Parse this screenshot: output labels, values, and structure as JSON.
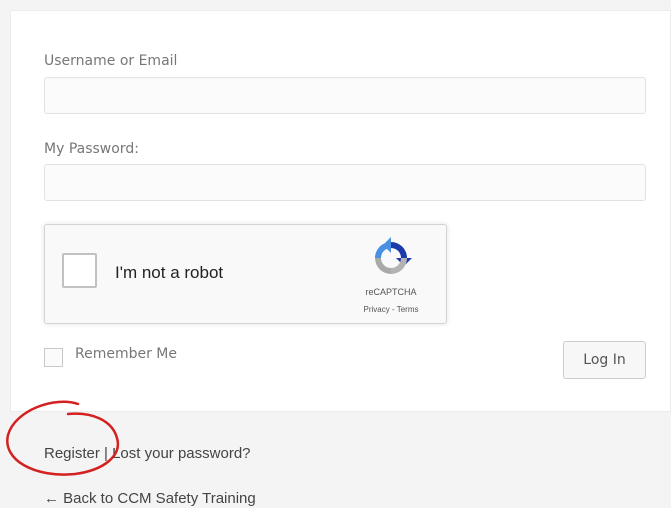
{
  "form": {
    "username_label": "Username or Email",
    "username_value": "",
    "password_label": "My Password:",
    "password_value": "",
    "remember_label": "Remember Me",
    "login_button_label": "Log In"
  },
  "recaptcha": {
    "checkbox_text": "I'm not a robot",
    "brand": "reCAPTCHA",
    "privacy_link": "Privacy",
    "separator": " - ",
    "terms_link": "Terms",
    "icon": "recaptcha-logo-icon"
  },
  "links": {
    "register": "Register",
    "separator": " | ",
    "lost_password": "Lost your password?",
    "back": "← Back to CCM Safety Training"
  },
  "annotation": {
    "color": "#d42020",
    "icon": "hand-drawn-circle-icon"
  }
}
